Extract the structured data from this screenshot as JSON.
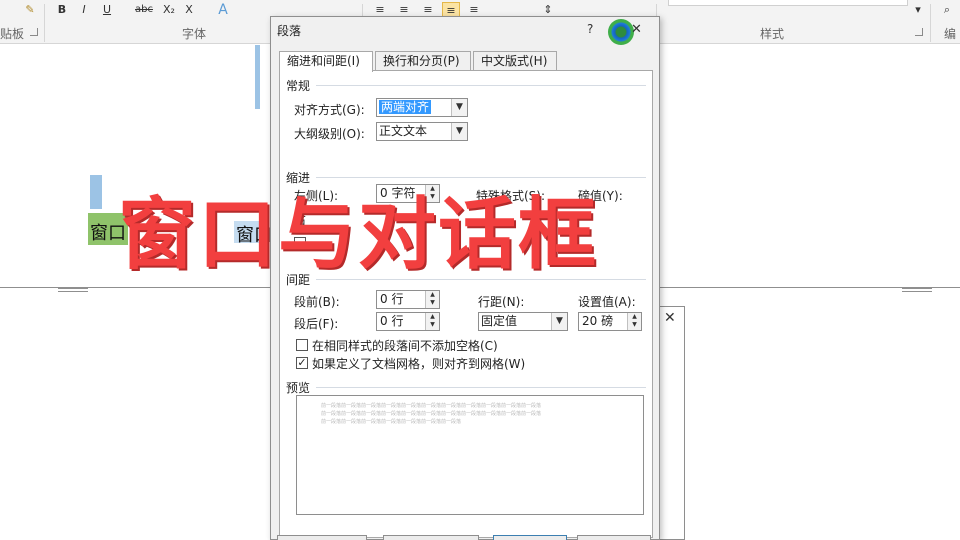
{
  "ribbon": {
    "clipboard_label": "贴板",
    "font_label": "字体",
    "paragraph_label": "段落",
    "styles_label": "样式",
    "edit_label": "编",
    "font_buttons": [
      "B",
      "I",
      "U",
      "abc",
      "X₂",
      "X"
    ]
  },
  "document": {
    "text_left": "窗口",
    "text_right": "窗口"
  },
  "overlay": {
    "title": "窗口与对话框"
  },
  "dialog": {
    "title": "段落",
    "help": "?",
    "close": "✕",
    "tabs": [
      {
        "label": "缩进和间距(I)",
        "active": true
      },
      {
        "label": "换行和分页(P)",
        "active": false
      },
      {
        "label": "中文版式(H)",
        "active": false
      }
    ],
    "general": {
      "heading": "常规",
      "align_label": "对齐方式(G):",
      "align_value": "两端对齐",
      "outline_label": "大纲级别(O):",
      "outline_value": "正文文本"
    },
    "indent": {
      "heading": "缩进",
      "left_label": "左侧(L):",
      "left_value": "0 字符",
      "right_label": "右",
      "special_label": "特殊格式(S):",
      "by_label": "磅值(Y):"
    },
    "spacing": {
      "heading": "间距",
      "before_label": "段前(B):",
      "before_value": "0 行",
      "after_label": "段后(F):",
      "after_value": "0 行",
      "line_spacing_label": "行距(N):",
      "line_spacing_value": "固定值",
      "at_label": "设置值(A):",
      "at_value": "20 磅",
      "no_space_same_style": "在相同样式的段落间不添加空格(C)",
      "no_space_checked": false,
      "snap_to_grid": "如果定义了文档网格，则对齐到网格(W)",
      "snap_checked": true
    },
    "preview": {
      "heading": "预览",
      "sample_lines": [
        "前一段落前一段落前一段落前一段落前一段落前一段落前一段落前一段落前一段落前一段落前一段落",
        "前一段落前一段落前一段落前一段落前一段落前一段落前一段落前一段落前一段落前一段落前一段落",
        "前一段落前一段落前一段落前一段落前一段落前一段落前一段落"
      ]
    }
  },
  "background_dialog": {
    "close": "✕"
  }
}
